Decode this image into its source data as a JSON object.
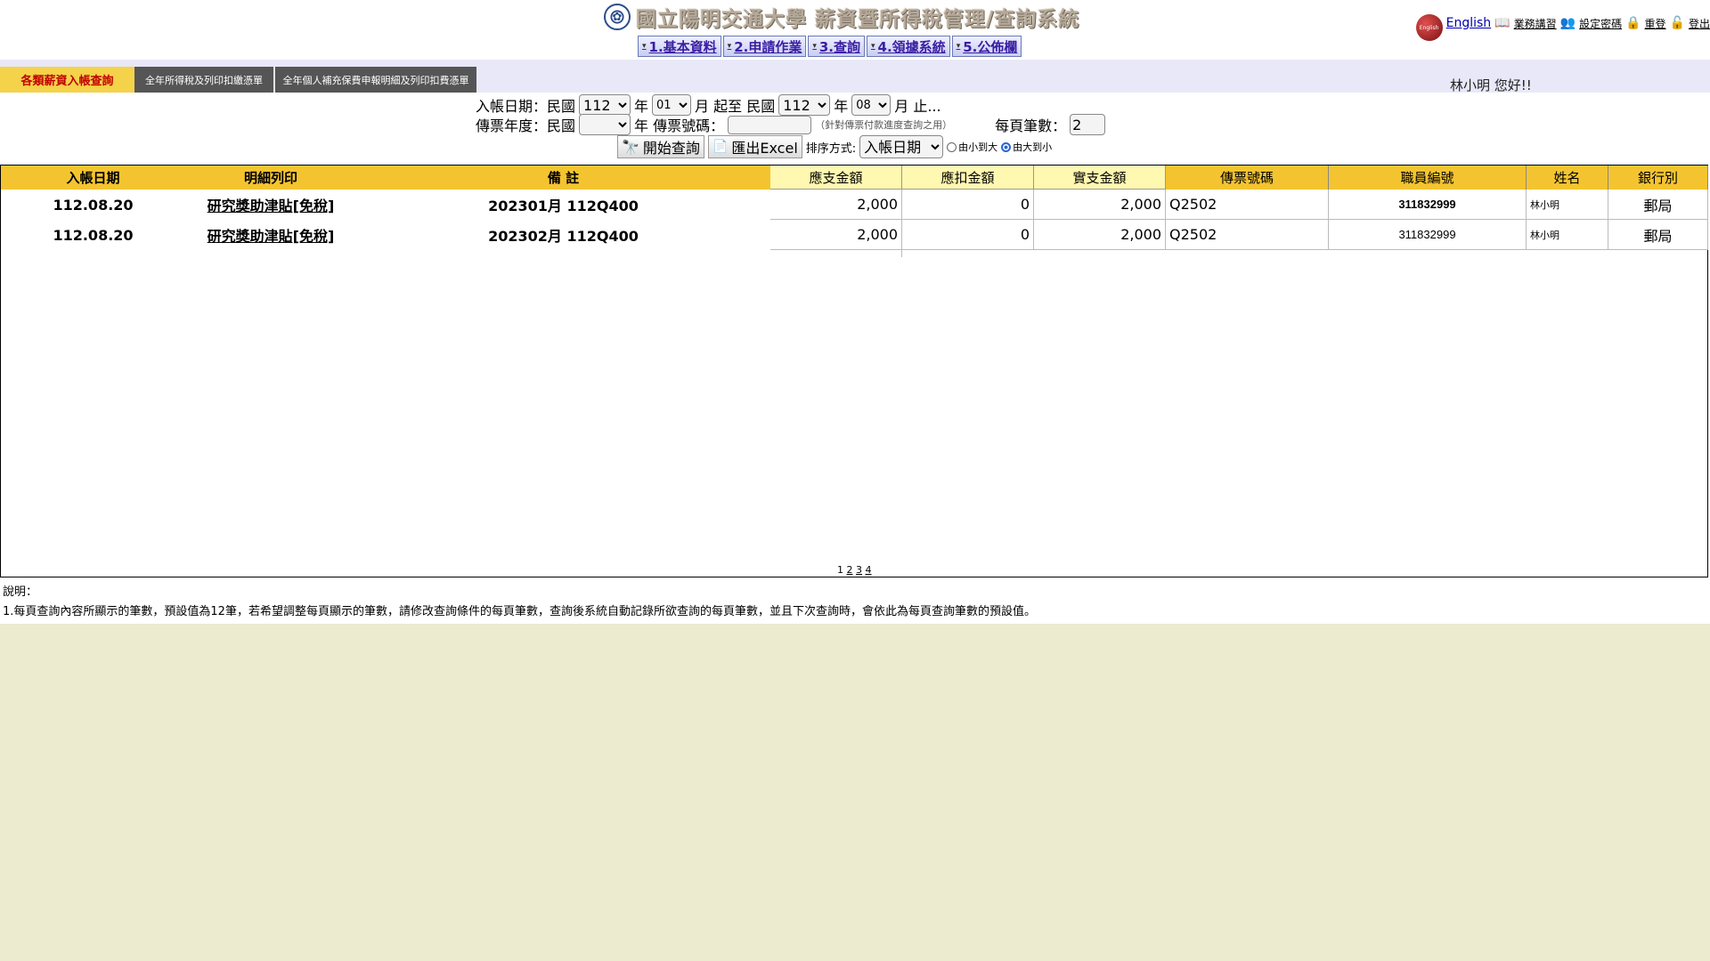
{
  "header": {
    "title": "國立陽明交通大學  薪資暨所得稅管理/查詢系統",
    "logo_glyph": "✿",
    "links": {
      "english_badge": "English",
      "english": "English",
      "training": "業務講習",
      "set_password": "設定密碼",
      "relogin": "重登",
      "logout": "登出"
    }
  },
  "nav": [
    {
      "label": "1.基本資料"
    },
    {
      "label": "2.申請作業"
    },
    {
      "label": "3.查詢"
    },
    {
      "label": "4.領據系統"
    },
    {
      "label": "5.公佈欄"
    }
  ],
  "tabs": [
    {
      "label": "各類薪資入帳查詢"
    },
    {
      "label": "全年所得稅及列印扣繳憑單"
    },
    {
      "label": "全年個人補充保費申報明細及列印扣費憑單"
    }
  ],
  "greeting": "林小明  您好!!",
  "form": {
    "entry_date_label": "入帳日期：民國",
    "from_year": "112",
    "year_label": "年",
    "from_month": "01",
    "month_to_label": "月 起至 民國",
    "to_year": "112",
    "to_month": "08",
    "month_end_label": "月 止...",
    "voucher_year_label": "傳票年度：民國",
    "voucher_year": "",
    "voucher_no_label": "年 傳票號碼：",
    "voucher_no": "",
    "voucher_hint": "（針對傳票付款進度查詢之用）",
    "per_page_label": "每頁筆數：",
    "per_page": "2",
    "search_button": "開始查詢",
    "export_button": "匯出Excel",
    "sort_label": "排序方式:",
    "sort_by": "入帳日期",
    "asc_label": "由小到大",
    "desc_label": "由大到小",
    "sort_order": "desc"
  },
  "table": {
    "headers": [
      "入帳日期",
      "明細列印",
      "備 註",
      "應支金額",
      "應扣金額",
      "實支金額",
      "傳票號碼",
      "職員編號",
      "姓名",
      "銀行別"
    ],
    "rows": [
      {
        "date": "112.08.20",
        "detail": "研究獎助津貼[免稅]",
        "note": "202301月 112Q400",
        "payable": "2,000",
        "deduct": "0",
        "actual": "2,000",
        "voucher": "Q2502",
        "staff_id": "311832999",
        "name": "林小明",
        "bank": "郵局"
      },
      {
        "date": "112.08.20",
        "detail": "研究獎助津貼[免稅]",
        "note": "202302月 112Q400",
        "payable": "2,000",
        "deduct": "0",
        "actual": "2,000",
        "voucher": "Q2502",
        "staff_id": "311832999",
        "name": "林小明",
        "bank": "郵局"
      }
    ]
  },
  "pager": {
    "current": "1",
    "pages": [
      "2",
      "3",
      "4"
    ]
  },
  "notes": {
    "title": "說明：",
    "line1": "1.每頁查詢內容所顯示的筆數，預設值為12筆，若希望調整每頁顯示的筆數，請修改查詢條件的每頁筆數，查詢後系統自動記錄所欲查詢的每頁筆數，並且下次查詢時，會依此為每頁查詢筆數的預設值。"
  },
  "colors": {
    "page_bg": "#eceacf",
    "header_gold": "#f4c430",
    "header_pale": "#fff8b0",
    "active_tab_text": "#c00000",
    "nav_text": "#3a1fa3"
  }
}
